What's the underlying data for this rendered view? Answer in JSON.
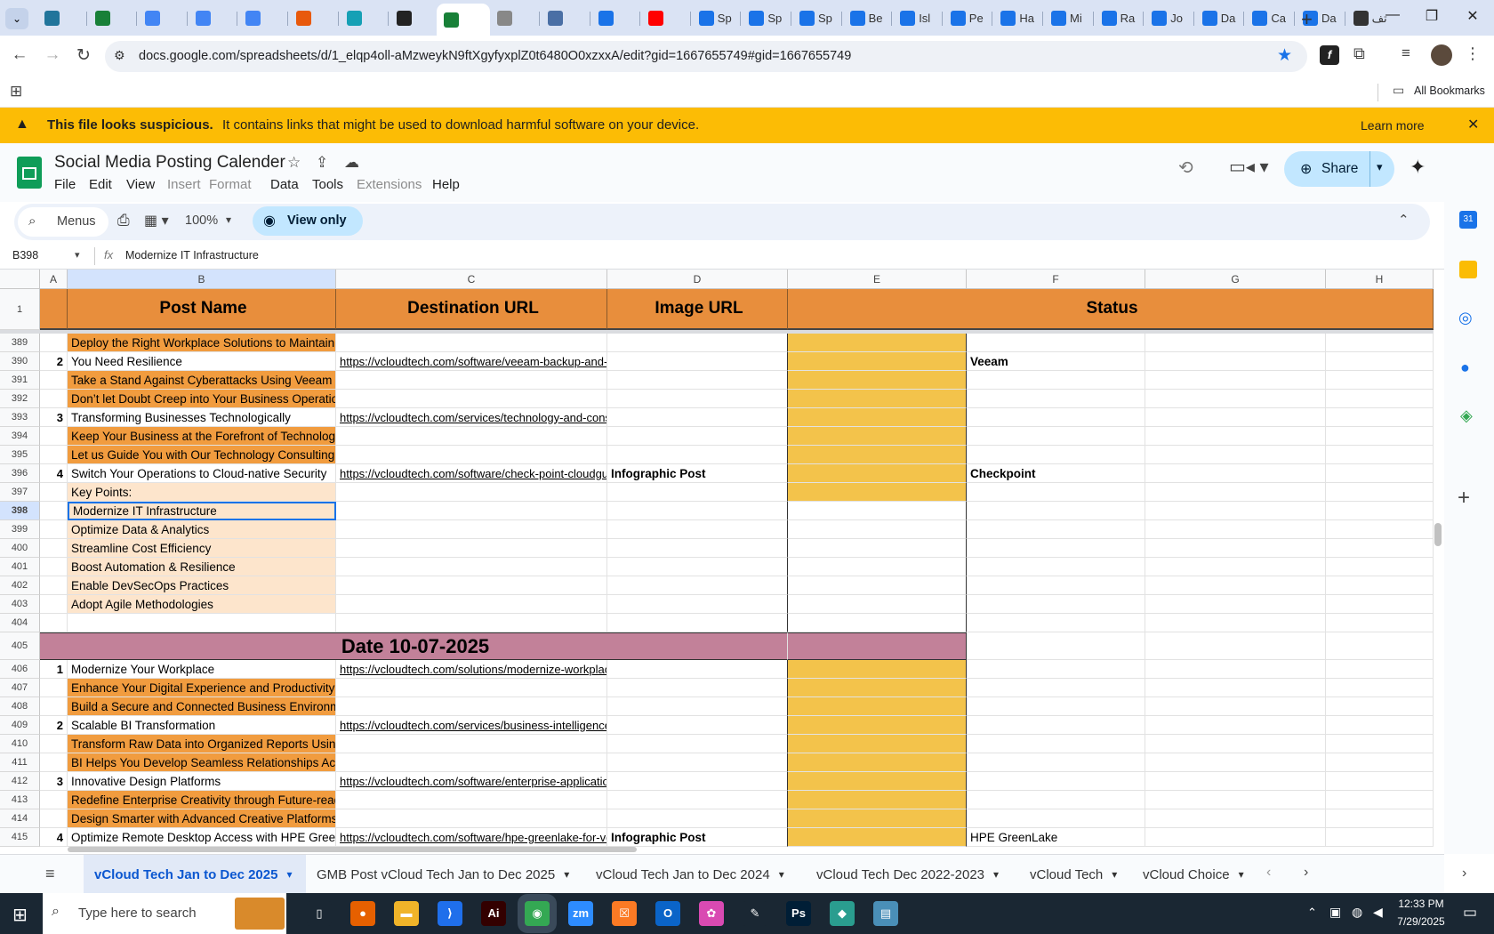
{
  "browser": {
    "tabs": [
      {
        "label": "",
        "icon": "wordpress-icon",
        "color": "#21759b"
      },
      {
        "label": "",
        "icon": "sheets-plus-icon",
        "color": "#188038"
      },
      {
        "label": "",
        "icon": "docs-icon",
        "color": "#4285f4"
      },
      {
        "label": "",
        "icon": "docs-icon",
        "color": "#4285f4"
      },
      {
        "label": "",
        "icon": "docs-icon",
        "color": "#4285f4"
      },
      {
        "label": "",
        "icon": "cms-icon",
        "color": "#e8590c"
      },
      {
        "label": "",
        "icon": "gem-icon",
        "color": "#16a0b5"
      },
      {
        "label": "",
        "icon": "openai-icon",
        "color": "#222222"
      },
      {
        "label": "",
        "icon": "sheets-icon",
        "color": "#188038",
        "active": true
      },
      {
        "label": "",
        "icon": "globe-icon",
        "color": "#888888"
      },
      {
        "label": "",
        "icon": "grid-icon",
        "color": "#4a6fa5"
      },
      {
        "label": "",
        "icon": "forms-icon",
        "color": "#1a73e8"
      },
      {
        "label": "",
        "icon": "youtube-icon",
        "color": "#ff0000"
      },
      {
        "label": "Sp",
        "icon": "forms-icon",
        "color": "#1a73e8"
      },
      {
        "label": "Sp",
        "icon": "forms-icon",
        "color": "#1a73e8"
      },
      {
        "label": "Sp",
        "icon": "forms-icon",
        "color": "#1a73e8"
      },
      {
        "label": "Be",
        "icon": "forms-icon",
        "color": "#1a73e8"
      },
      {
        "label": "Isl",
        "icon": "forms-icon",
        "color": "#1a73e8"
      },
      {
        "label": "Pe",
        "icon": "forms-icon",
        "color": "#1a73e8"
      },
      {
        "label": "Ha",
        "icon": "forms-icon",
        "color": "#1a73e8"
      },
      {
        "label": "Mi",
        "icon": "forms-icon",
        "color": "#1a73e8"
      },
      {
        "label": "Ra",
        "icon": "forms-icon",
        "color": "#1a73e8"
      },
      {
        "label": "Jo",
        "icon": "forms-icon",
        "color": "#1a73e8"
      },
      {
        "label": "Da",
        "icon": "forms-icon",
        "color": "#1a73e8"
      },
      {
        "label": "Ca",
        "icon": "forms-icon",
        "color": "#1a73e8"
      },
      {
        "label": "Da",
        "icon": "forms-icon",
        "color": "#1a73e8"
      },
      {
        "label": "تف",
        "icon": "openai-icon",
        "color": "#333333"
      }
    ],
    "url": "docs.google.com/spreadsheets/d/1_elqp4oll-aMzweykN9ftXgyfyxplZ0t6480O0xzxxA/edit?gid=1667655749#gid=1667655749",
    "bookmarks_label": "All Bookmarks"
  },
  "warning": {
    "title": "This file looks suspicious.",
    "message": "It contains links that might be used to download harmful software on your device.",
    "action": "Learn more"
  },
  "doc": {
    "title": "Social Media Posting Calender",
    "menus": [
      {
        "label": "File",
        "dim": false
      },
      {
        "label": "Edit",
        "dim": false
      },
      {
        "label": "View",
        "dim": false
      },
      {
        "label": "Insert",
        "dim": true
      },
      {
        "label": "Format",
        "dim": true
      },
      {
        "label": "Data",
        "dim": false
      },
      {
        "label": "Tools",
        "dim": false
      },
      {
        "label": "Extensions",
        "dim": true
      },
      {
        "label": "Help",
        "dim": false
      }
    ],
    "share_label": "Share",
    "toolbar": {
      "menus_label": "Menus",
      "zoom": "100%",
      "view_only": "View only"
    },
    "formula": {
      "cell_ref": "B398",
      "value": "Modernize IT Infrastructure"
    }
  },
  "colors": {
    "orange": "#f19c3f",
    "peach": "#fde5cc",
    "gold": "#f3c34b",
    "mauve": "#c28199",
    "header": "#e88e3c",
    "selection": "#1a73e8"
  },
  "grid": {
    "columns": [
      "A",
      "B",
      "C",
      "D",
      "E",
      "F",
      "G",
      "H"
    ],
    "header_row": {
      "num": "1",
      "post_name": "Post Name",
      "destination": "Destination URL",
      "image": "Image URL",
      "status": "Status"
    },
    "rows": [
      {
        "num": "389",
        "a": "",
        "b": "Deploy the Right Workplace Solutions to Maintain Business Continuity",
        "c": "",
        "d": "",
        "f": "",
        "bfill": "orange",
        "efill": true
      },
      {
        "num": "390",
        "a": "2",
        "b": "You Need Resilience",
        "c": "https://vcloudtech.com/software/veeam-backup-and-replication",
        "d": "",
        "f": "Veeam",
        "bfill": "",
        "efill": true,
        "fbold": true
      },
      {
        "num": "391",
        "a": "",
        "b": "Take a Stand Against Cyberattacks Using Veeam Backup",
        "c": "",
        "d": "",
        "f": "",
        "bfill": "orange",
        "efill": true
      },
      {
        "num": "392",
        "a": "",
        "b": "Don’t let Doubt Creep into Your Business Operations",
        "c": "",
        "d": "",
        "f": "",
        "bfill": "orange",
        "efill": true
      },
      {
        "num": "393",
        "a": "3",
        "b": "Transforming Businesses Technologically",
        "c": "https://vcloudtech.com/services/technology-and-consulting",
        "d": "",
        "f": "",
        "bfill": "",
        "efill": true
      },
      {
        "num": "394",
        "a": "",
        "b": "Keep Your Business at the Forefront of Technology",
        "c": "",
        "d": "",
        "f": "",
        "bfill": "orange",
        "efill": true
      },
      {
        "num": "395",
        "a": "",
        "b": "Let us Guide You with Our Technology Consulting",
        "c": "",
        "d": "",
        "f": "",
        "bfill": "orange",
        "efill": true
      },
      {
        "num": "396",
        "a": "4",
        "b": "Switch Your Operations to Cloud-native Security",
        "c": "https://vcloudtech.com/software/check-point-cloudguard",
        "d": "Infographic Post",
        "f": "Checkpoint",
        "bfill": "",
        "efill": true,
        "fbold": true,
        "dbold": true
      },
      {
        "num": "397",
        "a": "",
        "b": "Key Points:",
        "c": "",
        "d": "",
        "f": "",
        "bfill": "peach",
        "efill": true
      },
      {
        "num": "398",
        "a": "",
        "b": "Modernize IT Infrastructure",
        "c": "",
        "d": "",
        "f": "",
        "bfill": "peach",
        "efill": false,
        "selected": true
      },
      {
        "num": "399",
        "a": "",
        "b": "Optimize Data & Analytics",
        "c": "",
        "d": "",
        "f": "",
        "bfill": "peach",
        "efill": false
      },
      {
        "num": "400",
        "a": "",
        "b": "Streamline Cost Efficiency",
        "c": "",
        "d": "",
        "f": "",
        "bfill": "peach",
        "efill": false
      },
      {
        "num": "401",
        "a": "",
        "b": "Boost Automation & Resilience",
        "c": "",
        "d": "",
        "f": "",
        "bfill": "peach",
        "efill": false
      },
      {
        "num": "402",
        "a": "",
        "b": "Enable DevSecOps Practices",
        "c": "",
        "d": "",
        "f": "",
        "bfill": "peach",
        "efill": false
      },
      {
        "num": "403",
        "a": "",
        "b": "Adopt Agile Methodologies",
        "c": "",
        "d": "",
        "f": "",
        "bfill": "peach",
        "efill": false
      },
      {
        "num": "404",
        "a": "",
        "b": "",
        "c": "",
        "d": "",
        "f": "",
        "bfill": "",
        "efill": false
      },
      {
        "num": "405",
        "date": "Date 10-07-2025"
      },
      {
        "num": "406",
        "a": "1",
        "b": "Modernize Your Workplace",
        "c": "https://vcloudtech.com/solutions/modernize-workplace",
        "d": "",
        "f": "",
        "bfill": "",
        "efill": true
      },
      {
        "num": "407",
        "a": "",
        "b": "Enhance Your Digital Experience and Productivity with Microsoft",
        "c": "",
        "d": "",
        "f": "",
        "bfill": "orange",
        "efill": true
      },
      {
        "num": "408",
        "a": "",
        "b": "Build a Secure and Connected Business Environment",
        "c": "",
        "d": "",
        "f": "",
        "bfill": "orange",
        "efill": true
      },
      {
        "num": "409",
        "a": "2",
        "b": "Scalable BI Transformation",
        "c": "https://vcloudtech.com/services/business-intelligence",
        "d": "",
        "f": "",
        "bfill": "",
        "efill": true
      },
      {
        "num": "410",
        "a": "",
        "b": "Transform Raw Data into Organized Reports Using BI",
        "c": "",
        "d": "",
        "f": "",
        "bfill": "orange",
        "efill": true
      },
      {
        "num": "411",
        "a": "",
        "b": "BI Helps You Develop Seamless Relationships Across Teams",
        "c": "",
        "d": "",
        "f": "",
        "bfill": "orange",
        "efill": true
      },
      {
        "num": "412",
        "a": "3",
        "b": "Innovative Design Platforms",
        "c": "https://vcloudtech.com/software/enterprise-applications",
        "d": "",
        "f": "",
        "bfill": "",
        "efill": true
      },
      {
        "num": "413",
        "a": "",
        "b": "Redefine Enterprise Creativity through Future-ready Platforms",
        "c": "",
        "d": "",
        "f": "",
        "bfill": "orange",
        "efill": true
      },
      {
        "num": "414",
        "a": "",
        "b": "Design Smarter with Advanced Creative Platforms",
        "c": "",
        "d": "",
        "f": "",
        "bfill": "orange",
        "efill": true
      },
      {
        "num": "415",
        "a": "4",
        "b": "Optimize Remote Desktop Access with HPE GreenLake",
        "c": "https://vcloudtech.com/software/hpe-greenlake-for-vdi",
        "d": "Infographic Post",
        "f": "HPE GreenLake",
        "bfill": "",
        "efill": true,
        "dbold": true
      }
    ]
  },
  "sheet_tabs": [
    {
      "label": "vCloud Tech Jan to Dec 2025",
      "active": true
    },
    {
      "label": "GMB Post vCloud Tech Jan to Dec 2025",
      "active": false
    },
    {
      "label": "vCloud Tech Jan to Dec 2024",
      "active": false
    },
    {
      "label": "vCloud Tech Dec 2022-2023",
      "active": false
    },
    {
      "label": "vCloud Tech",
      "active": false
    },
    {
      "label": "vCloud Choice",
      "active": false
    }
  ],
  "taskbar": {
    "search_placeholder": "Type here to search",
    "time": "12:33 PM",
    "date": "7/29/2025",
    "apps": [
      {
        "name": "task-view-icon",
        "glyph": "▯",
        "color": "#1a2733"
      },
      {
        "name": "firefox-icon",
        "glyph": "●",
        "color": "#e66000"
      },
      {
        "name": "file-explorer-icon",
        "glyph": "▬",
        "color": "#f0b429"
      },
      {
        "name": "vscode-icon",
        "glyph": "⟩",
        "color": "#1f6feb"
      },
      {
        "name": "illustrator-icon",
        "glyph": "Ai",
        "color": "#330000"
      },
      {
        "name": "chrome-icon",
        "glyph": "◉",
        "color": "#34a853"
      },
      {
        "name": "zoom-icon",
        "glyph": "zm",
        "color": "#2d8cff"
      },
      {
        "name": "xampp-icon",
        "glyph": "☒",
        "color": "#fb7a24"
      },
      {
        "name": "outlook-icon",
        "glyph": "O",
        "color": "#0a64c8"
      },
      {
        "name": "photos-icon",
        "glyph": "✿",
        "color": "#d94ab2"
      },
      {
        "name": "pen-tool-icon",
        "glyph": "✎",
        "color": "#1a2733"
      },
      {
        "name": "photoshop-icon",
        "glyph": "Ps",
        "color": "#001e36"
      },
      {
        "name": "app-diamond-icon",
        "glyph": "◆",
        "color": "#2a9d8f"
      },
      {
        "name": "notepad-icon",
        "glyph": "▤",
        "color": "#4a8fb8"
      }
    ]
  }
}
